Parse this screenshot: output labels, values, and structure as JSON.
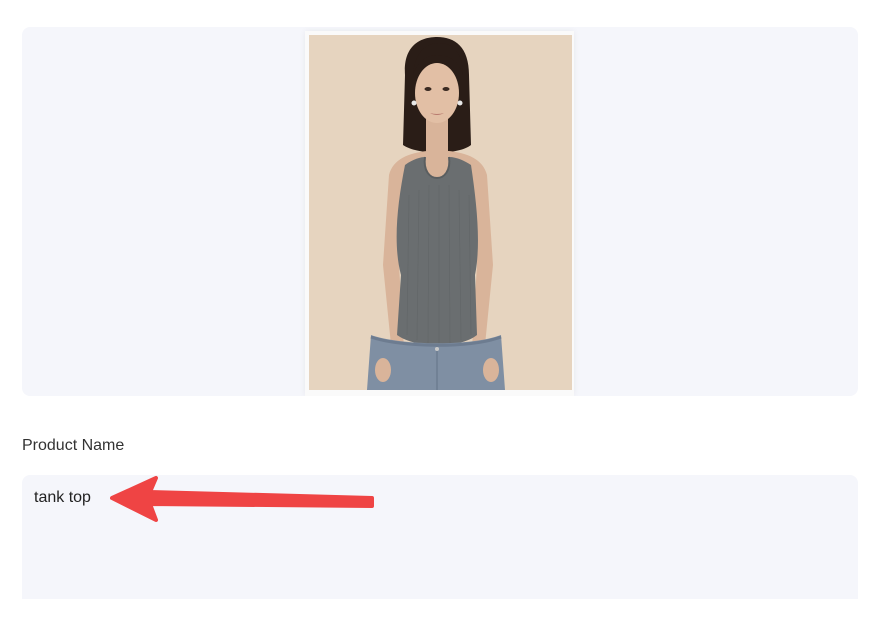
{
  "product_image": {
    "icon": "product-photo-woman-in-gray-tank-top",
    "colors": {
      "panel_background": "#f5f6fb",
      "photo_background": "#e3d2bd",
      "garment": "#6a6e70",
      "denim": "#7f8fa3"
    }
  },
  "form": {
    "product_name": {
      "label": "Product Name",
      "value": "tank top"
    }
  },
  "annotation": {
    "icon": "red-arrow-icon",
    "color": "#ef4444"
  }
}
